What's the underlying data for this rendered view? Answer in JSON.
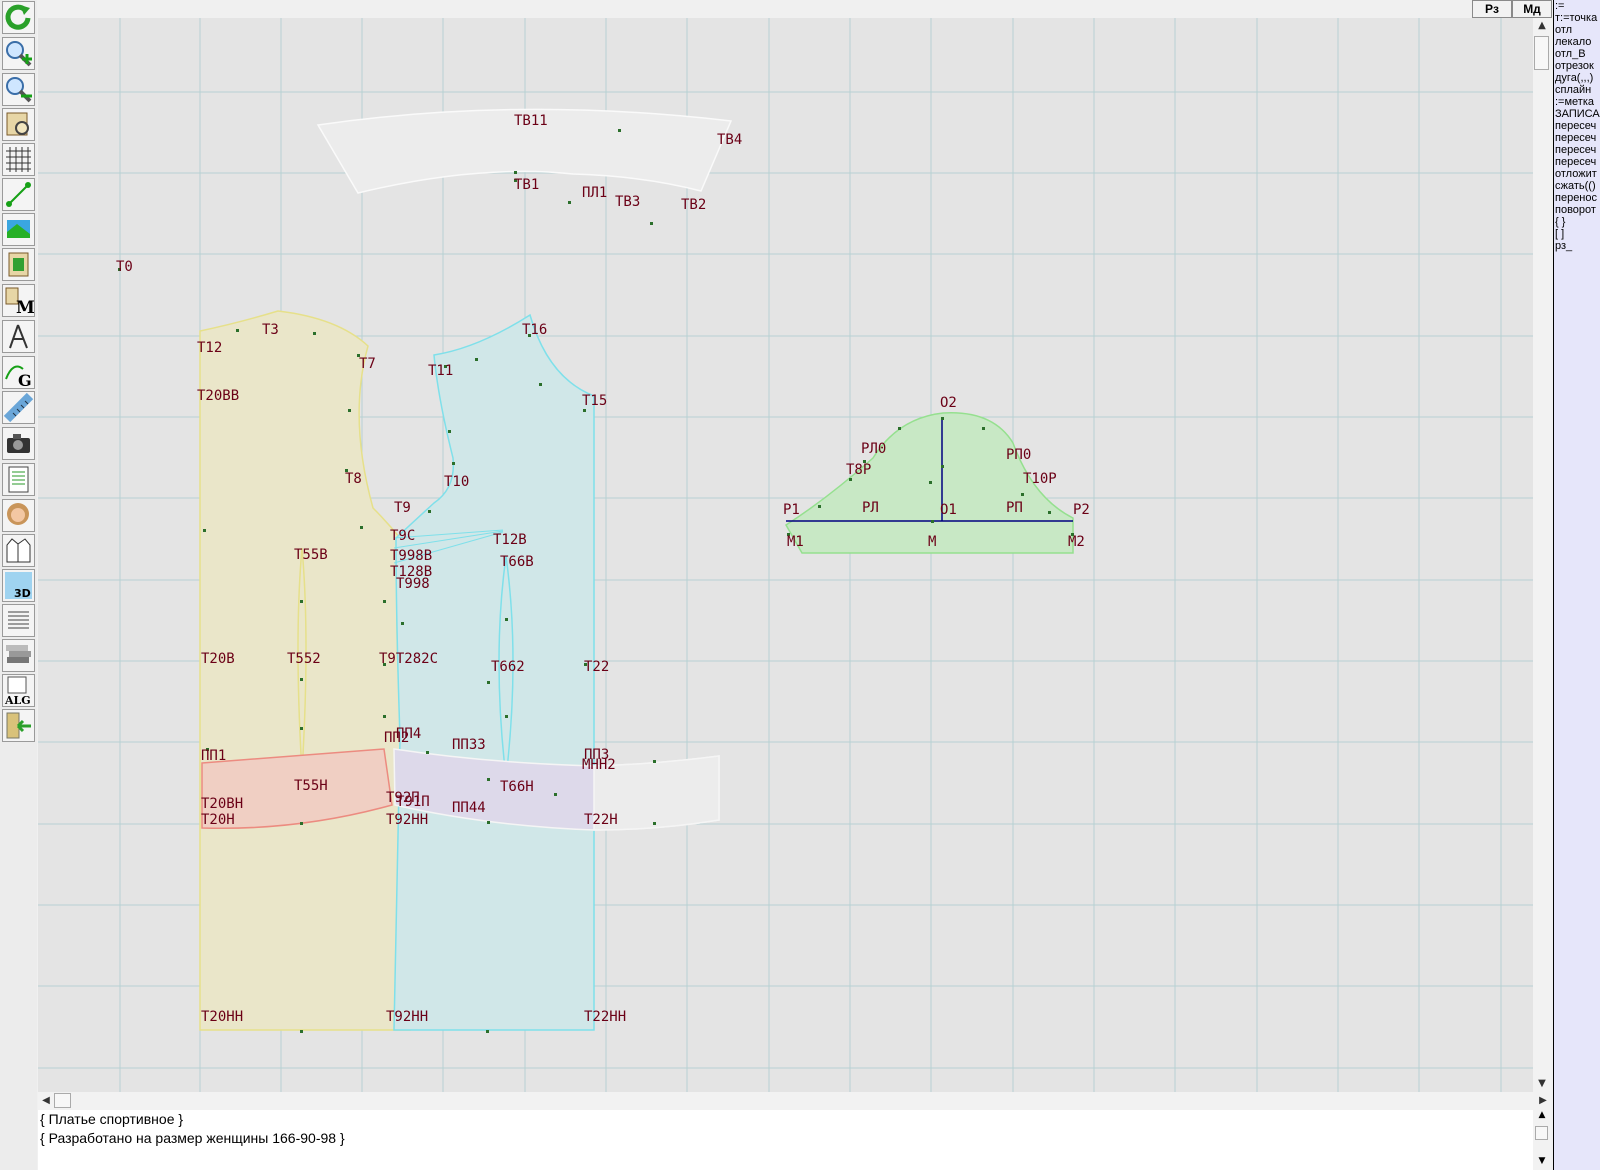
{
  "toolbar": {
    "tools": [
      {
        "icon": "refresh-icon"
      },
      {
        "icon": "zoom-in-icon"
      },
      {
        "icon": "zoom-out-icon"
      },
      {
        "icon": "map-view-icon"
      },
      {
        "icon": "grid-icon"
      },
      {
        "icon": "line-tool-icon"
      },
      {
        "icon": "color-fill-icon"
      },
      {
        "icon": "pattern-icon"
      },
      {
        "icon": "measure-m-icon"
      },
      {
        "icon": "compass-icon"
      },
      {
        "icon": "curve-g-icon"
      },
      {
        "icon": "ruler-icon"
      },
      {
        "icon": "camera-icon"
      },
      {
        "icon": "sheet-icon"
      },
      {
        "icon": "portrait-icon"
      },
      {
        "icon": "garment-icon"
      },
      {
        "icon": "3d-icon"
      },
      {
        "icon": "text-lines-icon"
      },
      {
        "icon": "stack-icon"
      },
      {
        "icon": "alg-icon"
      },
      {
        "icon": "exit-icon"
      }
    ],
    "icon_labels": {
      "measure": "M",
      "curve": "G",
      "three_d": "3D",
      "alg": "ALG"
    }
  },
  "tabs": [
    {
      "label": "Рз"
    },
    {
      "label": "Мд"
    }
  ],
  "command_panel": {
    "items": [
      ":=",
      "т:=точка",
      "отл",
      "лекало",
      "отл_В",
      "отрезок",
      "дуга(,,,)",
      "сплайн",
      ":=метка",
      "ЗАПИСА",
      "пересеч",
      "пересеч",
      "пересеч",
      "пересеч",
      "отложит",
      "сжать(()",
      "перенос",
      "поворот",
      "{ }",
      "[ ]",
      "рз_"
    ]
  },
  "comment": {
    "line1": "{ Платье спортивное }",
    "line2": "{ Разработано на размер женщины 166-90-98  }"
  },
  "drawing": {
    "colors": {
      "front": "#eae6c9",
      "front_stroke": "#e6e08a",
      "back": "#d0e7e8",
      "back_stroke": "#7fe0ea",
      "sleeve": "#c8e8c5",
      "sleeve_stroke": "#95e08f",
      "yoke_front": "#f0cfc3",
      "yoke_front_stroke": "#ec8b80",
      "yoke_back": "#ddd9ea",
      "yoke_back_stroke": "#f5f5f5",
      "collar": "#ececec",
      "collar_stroke": "#fafafa",
      "grid": "#b7d1d3",
      "label": "#6b0016",
      "point": "#2b6f2b"
    },
    "labels": [
      {
        "id": "t0",
        "text": "Т0"
      },
      {
        "id": "t2",
        "text": "Т12"
      },
      {
        "id": "t3",
        "text": "Т3"
      },
      {
        "id": "t7",
        "text": "Т7"
      },
      {
        "id": "t20vv",
        "text": "Т20ВВ"
      },
      {
        "id": "t8",
        "text": "Т8"
      },
      {
        "id": "t9",
        "text": "Т9"
      },
      {
        "id": "t9c",
        "text": "Т9С"
      },
      {
        "id": "t10",
        "text": "Т10"
      },
      {
        "id": "t11",
        "text": "Т11"
      },
      {
        "id": "t16",
        "text": "Т16"
      },
      {
        "id": "t15",
        "text": "Т15"
      },
      {
        "id": "t12",
        "text": "Т12В"
      },
      {
        "id": "t55v",
        "text": "Т55В"
      },
      {
        "id": "t998v",
        "text": "Т998В"
      },
      {
        "id": "t128v",
        "text": "Т128В"
      },
      {
        "id": "t998",
        "text": "Т998"
      },
      {
        "id": "t66v",
        "text": "Т66В"
      },
      {
        "id": "t20v",
        "text": "Т20В"
      },
      {
        "id": "t552",
        "text": "Т552"
      },
      {
        "id": "t282c",
        "text": "Т9Т282С"
      },
      {
        "id": "t662",
        "text": "Т662"
      },
      {
        "id": "t22",
        "text": "Т22"
      },
      {
        "id": "pp1",
        "text": "ПП1"
      },
      {
        "id": "pp2",
        "text": "ПП2"
      },
      {
        "id": "pp4",
        "text": "ПП4"
      },
      {
        "id": "pp33",
        "text": "ПП33"
      },
      {
        "id": "pp3",
        "text": "ПП3"
      },
      {
        "id": "mnh2",
        "text": "МНН2"
      },
      {
        "id": "t55n",
        "text": "Т55Н"
      },
      {
        "id": "t66n",
        "text": "Т66Н"
      },
      {
        "id": "t20vn",
        "text": "Т20ВН"
      },
      {
        "id": "t92p",
        "text": "Т92П"
      },
      {
        "id": "t91p",
        "text": "Т91П"
      },
      {
        "id": "pp44",
        "text": "ПП44"
      },
      {
        "id": "t20n",
        "text": "Т20Н"
      },
      {
        "id": "t92nn",
        "text": "Т92НН"
      },
      {
        "id": "t22n",
        "text": "Т22Н"
      },
      {
        "id": "t20nn",
        "text": "Т20НН"
      },
      {
        "id": "t92nnn",
        "text": "Т92НН"
      },
      {
        "id": "t22nn",
        "text": "Т22НН"
      },
      {
        "id": "tv11",
        "text": "ТВ11"
      },
      {
        "id": "tv4",
        "text": "ТВ4"
      },
      {
        "id": "tv1",
        "text": "ТВ1"
      },
      {
        "id": "pl1",
        "text": "ПЛ1"
      },
      {
        "id": "tv3",
        "text": "ТВ3"
      },
      {
        "id": "tv2",
        "text": "ТВ2"
      },
      {
        "id": "o2",
        "text": "О2"
      },
      {
        "id": "rl0",
        "text": "РЛ0"
      },
      {
        "id": "rp0",
        "text": "РП0"
      },
      {
        "id": "t8r",
        "text": "Т8Р"
      },
      {
        "id": "t10r",
        "text": "Т10Р"
      },
      {
        "id": "r1",
        "text": "Р1"
      },
      {
        "id": "rl",
        "text": "РЛ"
      },
      {
        "id": "o1",
        "text": "О1"
      },
      {
        "id": "rp",
        "text": "РП"
      },
      {
        "id": "r2",
        "text": "Р2"
      },
      {
        "id": "m1",
        "text": "М1"
      },
      {
        "id": "m",
        "text": "М"
      },
      {
        "id": "m2",
        "text": "М2"
      }
    ]
  }
}
